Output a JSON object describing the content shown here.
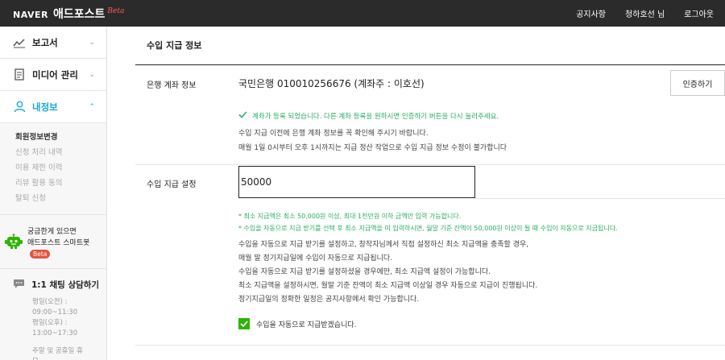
{
  "header": {
    "brand_naver": "NAVER",
    "brand_title": "애드포스트",
    "brand_beta": "Beta",
    "nav": [
      "공지사항",
      "청하호선 님",
      "로그아웃"
    ]
  },
  "sidebar": {
    "menu": [
      {
        "label": "보고서",
        "icon": "chart-line-icon"
      },
      {
        "label": "미디어 관리",
        "icon": "document-icon"
      },
      {
        "label": "내정보",
        "icon": "user-icon"
      }
    ],
    "submenu": [
      "회원정보변경",
      "신청 처리 내역",
      "이용 제한 이력",
      "리뷰 활용 동의",
      "탈퇴 신청"
    ],
    "bot": {
      "line1": "궁금한게 있으면",
      "line2": "애드포스트 스마트봇",
      "beta": "Beta"
    },
    "chat": {
      "title": "1:1 채팅 상담하기",
      "info": [
        "평일(오전) :",
        "09:00~11:30",
        "평일(오후) :",
        "13:00~17:30",
        "",
        "주말 및 공휴일 휴",
        "무"
      ]
    }
  },
  "main": {
    "section_title": "수입 지급 정보",
    "account_label": "은행 계좌 정보",
    "account_value": "국민은행 010010256676 (계좌주 : 이호선)",
    "verify_button": "인증하기",
    "green_message": "계좌가 등록 되었습니다. 다른 계좌 등록을 원하시면 인증하기 버튼을 다시 눌러주세요.",
    "notes": [
      "수입 지급 이전에 은행 계좌 정보를 꼭 확인해 주시기 바랍니다.",
      "매월 1일 0시부터 오후 1시까지는 지급 정산 작업으로 수입 지급 정보 수정이 불가합니다"
    ],
    "amount_label": "수입 지급 설정",
    "amount_value": "50000",
    "green_notes": [
      "* 최소 지급액은 최소 50,000원 이상, 최대 1천만원 이하 금액만 입력 가능합니다.",
      "* 수입을 자동으로 지급 받기를 선택 후 최소 지급액을 미 입력하시면, 월말 기준 잔액이 50,000원 이상이 될 때 수입이 자동으로 지급됩니다."
    ],
    "auto_notes": [
      "수입을 자동으로 지급 받기를 설정하고, 창작자님께서 직접 설정하신 최소 지급액을 충족할 경우,",
      "매월 말 정기지급일에 수입이 자동으로 지급됩니다.",
      "수입을 자동으로 지급 받기를 설정하셨을 경우에만, 최소 지급액 설정이 가능합니다.",
      "최소 지급액을 설정하시면, 월말 기준 잔액이 최소 지급액 이상일 경우 자동으로 지급이 진행됩니다.",
      "정기지급일의 정확한 일정은 공지사항에서 확인 가능합니다."
    ],
    "auto_checkbox_label": "수입을 자동으로 지급받겠습니다."
  },
  "colors": {
    "topbar": "#2b2b2b",
    "accent": "#1aa7d8",
    "green": "#27ae60",
    "check_green": "#2db400",
    "beta_red": "#e5533d"
  }
}
